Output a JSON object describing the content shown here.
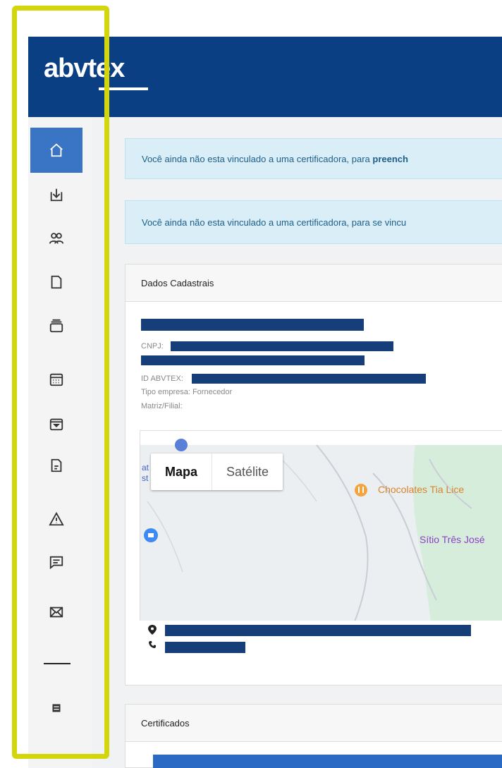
{
  "header": {
    "logo": "abvtex"
  },
  "sidebar": {
    "icons": [
      "home-icon",
      "download-icon",
      "users-icon",
      "document-icon",
      "inbox-icon",
      "calendar-icon",
      "box-icon",
      "file-text-icon",
      "warning-icon",
      "chat-icon",
      "mail-icon",
      "menu-list-icon"
    ]
  },
  "alerts": {
    "first": {
      "text": "Você ainda não esta vinculado a uma certificadora, para ",
      "bold": "preench"
    },
    "second": {
      "text": "Você ainda não esta vinculado a uma certificadora, para se vincu"
    }
  },
  "dados": {
    "heading": "Dados Cadastrais",
    "cnpj_label": "CNPJ:",
    "id_label": "ID ABVTEX:",
    "tipo_empresa": "Tipo empresa: Fornecedor",
    "matriz_filial": "Matriz/Filial:"
  },
  "map": {
    "toggle_map": "Mapa",
    "toggle_satellite": "Satélite",
    "poi_chocolates": "Chocolates Tia Lice",
    "poi_sitio": "Sítio Três José",
    "edge_text": "at\nst"
  },
  "certificados": {
    "heading": "Certificados"
  },
  "colors": {
    "brand": "#0b3f84",
    "accent": "#3a74c4",
    "highlight": "#d3d60a"
  }
}
